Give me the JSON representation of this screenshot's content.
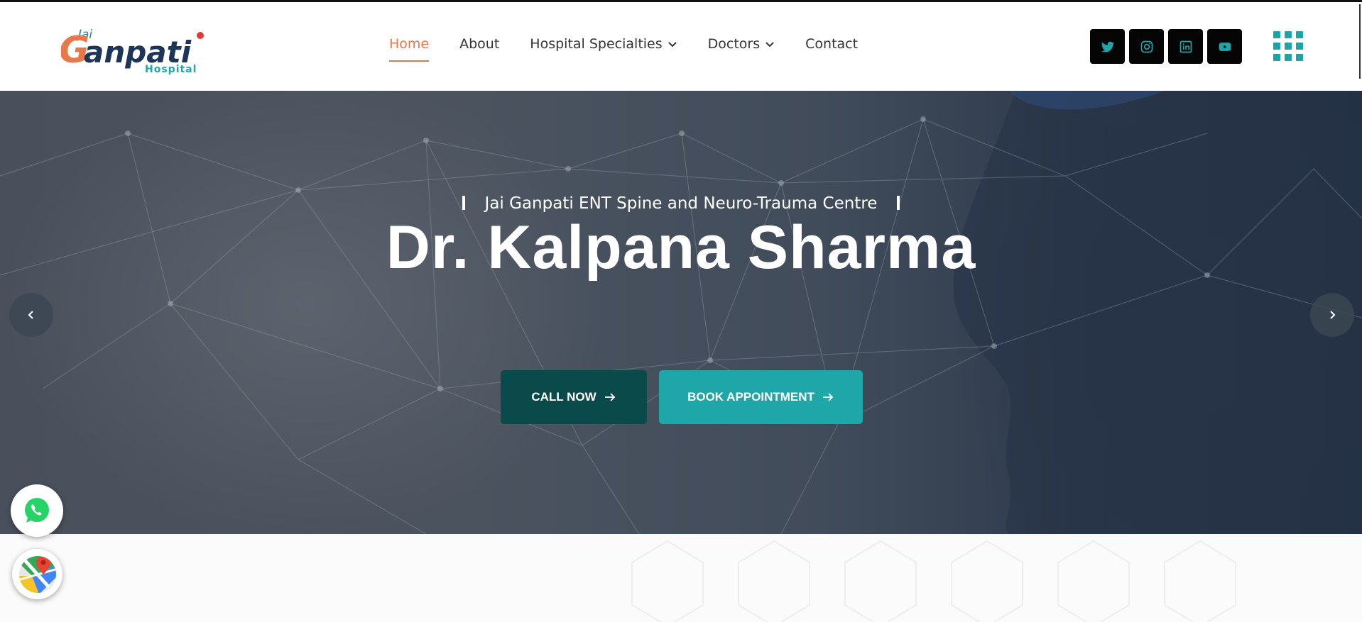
{
  "brand": {
    "logo_prefix": "Jai",
    "logo_main": "anpati",
    "logo_initial": "G",
    "logo_sub": "Hospital",
    "colors": {
      "orange": "#e8784a",
      "navy": "#1d3557",
      "teal": "#1ea6a8"
    }
  },
  "nav": {
    "items": [
      {
        "label": "Home",
        "active": true,
        "has_dropdown": false
      },
      {
        "label": "About",
        "active": false,
        "has_dropdown": false
      },
      {
        "label": "Hospital Specialties",
        "active": false,
        "has_dropdown": true
      },
      {
        "label": "Doctors",
        "active": false,
        "has_dropdown": true
      },
      {
        "label": "Contact",
        "active": false,
        "has_dropdown": false
      }
    ],
    "active_color": "#e8784a"
  },
  "socials": [
    {
      "icon": "twitter-icon"
    },
    {
      "icon": "instagram-icon"
    },
    {
      "icon": "linkedin-icon"
    },
    {
      "icon": "youtube-icon"
    }
  ],
  "menu_icon": "grid-menu-icon",
  "hero": {
    "subtitle": "Jai Ganpati ENT Spine and Neuro-Trauma Centre",
    "title": "Dr. Kalpana Sharma",
    "call_button": "CALL NOW",
    "book_button": "BOOK APPOINTMENT",
    "prev_icon": "chevron-left-icon",
    "next_icon": "chevron-right-icon",
    "call_color": "#0b4a4a",
    "book_color": "#1ea6a8"
  },
  "floating": {
    "whatsapp_icon": "whatsapp-icon",
    "maps_icon": "google-maps-icon"
  }
}
